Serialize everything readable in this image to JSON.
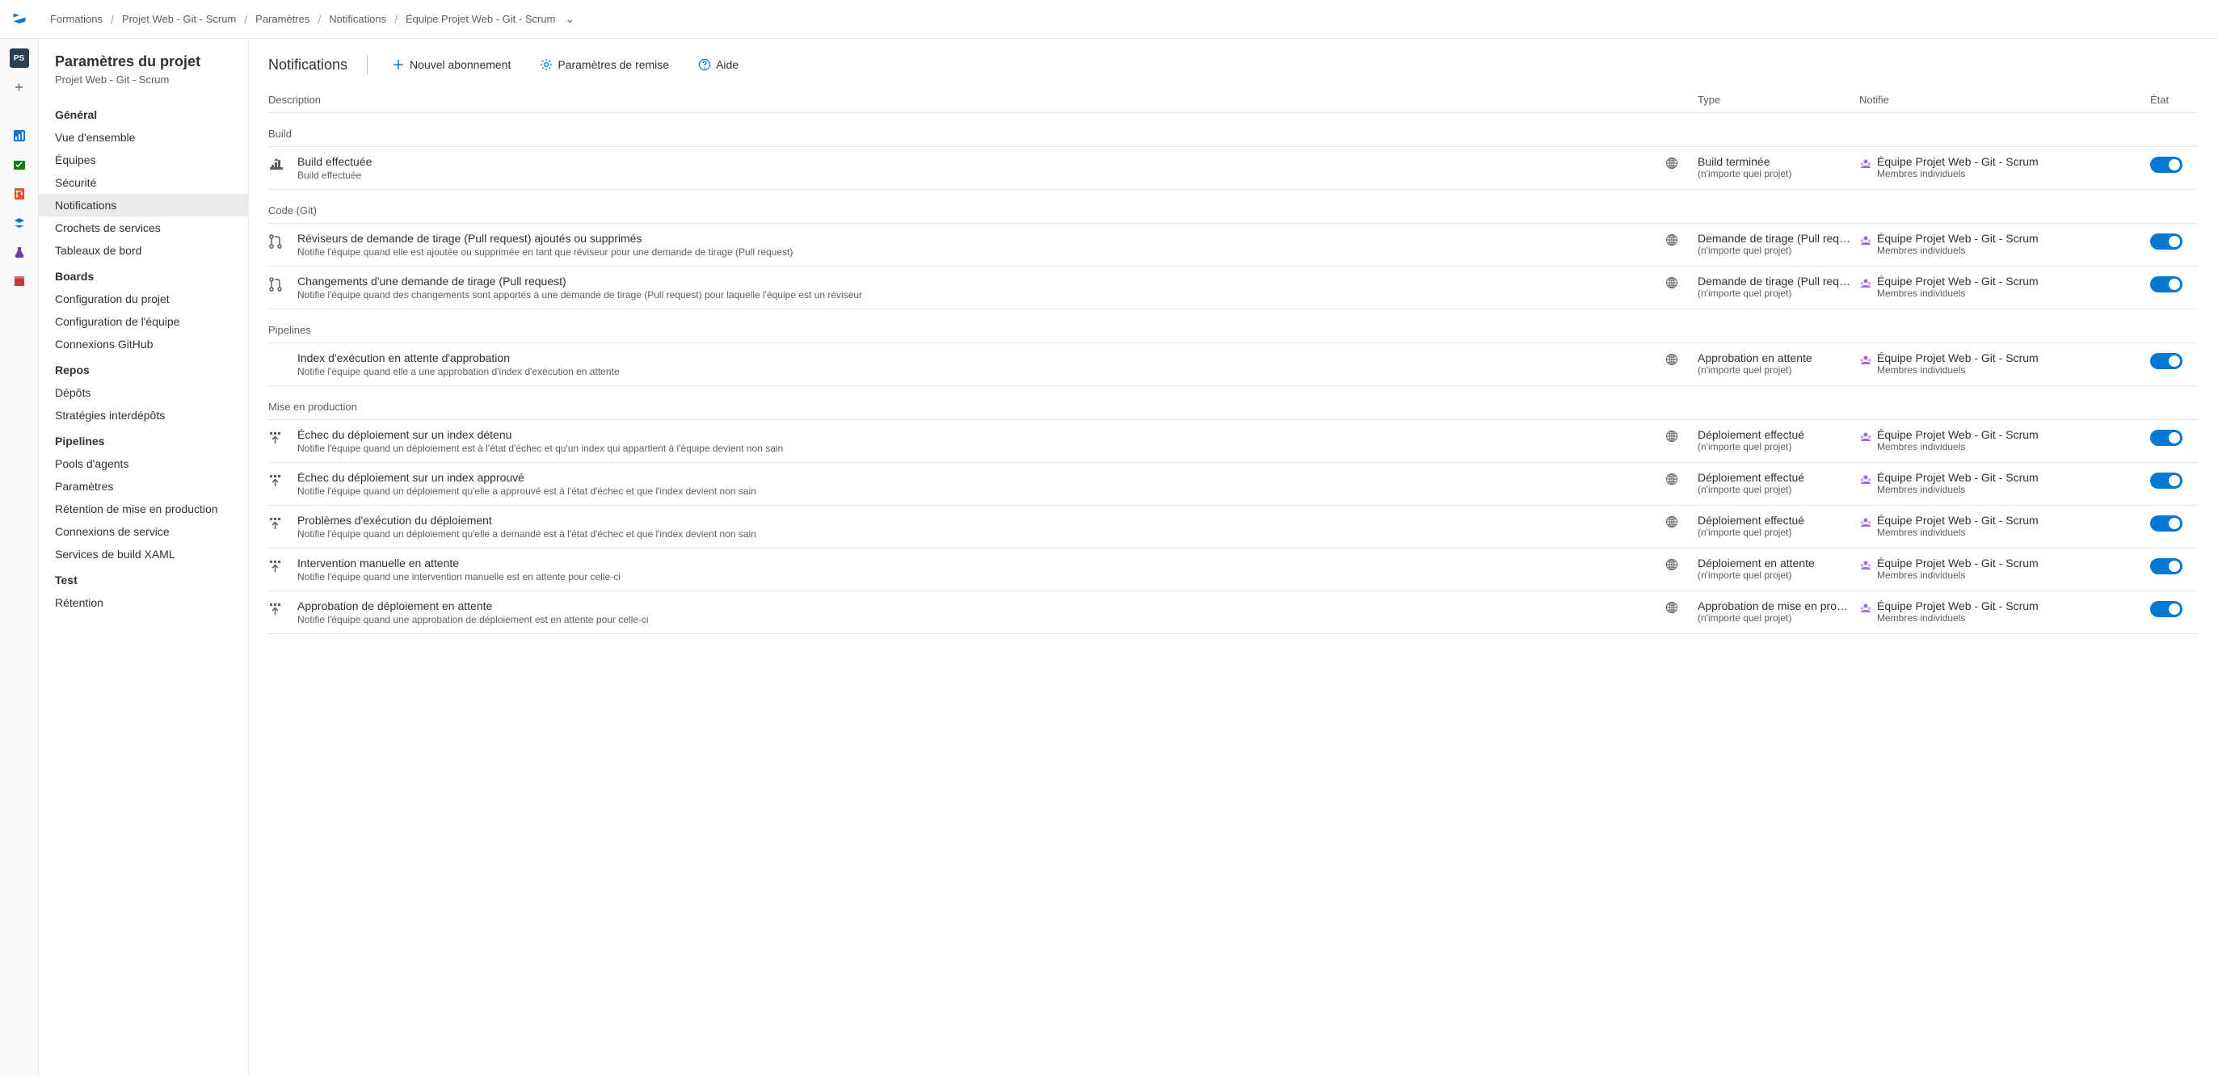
{
  "breadcrumb": {
    "items": [
      "Formations",
      "Projet Web - Git - Scrum",
      "Paramètres",
      "Notifications",
      "Équipe Projet Web - Git - Scrum"
    ]
  },
  "rail": {
    "project_initials": "PS"
  },
  "sidebar": {
    "title": "Paramètres du projet",
    "subtitle": "Projet Web - Git - Scrum",
    "groups": [
      {
        "label": "Général",
        "items": [
          "Vue d'ensemble",
          "Équipes",
          "Sécurité",
          "Notifications",
          "Crochets de services",
          "Tableaux de bord"
        ],
        "active": 3
      },
      {
        "label": "Boards",
        "items": [
          "Configuration du projet",
          "Configuration de l'équipe",
          "Connexions GitHub"
        ]
      },
      {
        "label": "Repos",
        "items": [
          "Dépôts",
          "Stratégies interdépôts"
        ]
      },
      {
        "label": "Pipelines",
        "items": [
          "Pools d'agents",
          "Paramètres",
          "Rétention de mise en production",
          "Connexions de service",
          "Services de build XAML"
        ]
      },
      {
        "label": "Test",
        "items": [
          "Rétention"
        ]
      }
    ]
  },
  "header": {
    "title": "Notifications",
    "cmd_new": "Nouvel abonnement",
    "cmd_delivery": "Paramètres de remise",
    "cmd_help": "Aide"
  },
  "columns": {
    "desc": "Description",
    "type": "Type",
    "notify": "Notifie",
    "state": "État"
  },
  "notify_target": {
    "name": "Équipe Projet Web - Git - Scrum",
    "role": "Membres individuels"
  },
  "any_project": "(n'importe quel projet)",
  "cats": [
    {
      "label": "Build",
      "rows": [
        {
          "icon": "build",
          "title": "Build effectuée",
          "sub": "Build effectuée",
          "type": "Build terminée"
        }
      ]
    },
    {
      "label": "Code (Git)",
      "rows": [
        {
          "icon": "pr",
          "title": "Réviseurs de demande de tirage (Pull request) ajoutés ou supprimés",
          "sub": "Notifie l'équipe quand elle est ajoutée ou supprimée en tant que réviseur pour une demande de tirage (Pull request)",
          "type": "Demande de tirage (Pull req…"
        },
        {
          "icon": "pr",
          "title": "Changements d'une demande de tirage (Pull request)",
          "sub": "Notifie l'équipe quand des changements sont apportés à une demande de tirage (Pull request) pour laquelle l'équipe est un réviseur",
          "type": "Demande de tirage (Pull req…"
        }
      ]
    },
    {
      "label": "Pipelines",
      "rows": [
        {
          "icon": "none",
          "title": "Index d'exécution en attente d'approbation",
          "sub": "Notifie l'équipe quand elle a une approbation d'index d'exécution en attente",
          "type": "Approbation en attente"
        }
      ]
    },
    {
      "label": "Mise en production",
      "rows": [
        {
          "icon": "deploy",
          "title": "Échec du déploiement sur un index détenu",
          "sub": "Notifie l'équipe quand un déploiement est à l'état d'échec et qu'un index qui appartient à l'équipe devient non sain",
          "type": "Déploiement effectué"
        },
        {
          "icon": "deploy",
          "title": "Échec du déploiement sur un index approuvé",
          "sub": "Notifie l'équipe quand un déploiement qu'elle a approuvé est à l'état d'échec et que l'index devient non sain",
          "type": "Déploiement effectué"
        },
        {
          "icon": "deploy",
          "title": "Problèmes d'exécution du déploiement",
          "sub": "Notifie l'équipe quand un déploiement qu'elle a demandé est à l'état d'échec et que l'index devient non sain",
          "type": "Déploiement effectué"
        },
        {
          "icon": "deploy",
          "title": "Intervention manuelle en attente",
          "sub": "Notifie l'équipe quand une intervention manuelle est en attente pour celle-ci",
          "type": "Déploiement en attente"
        },
        {
          "icon": "deploy",
          "title": "Approbation de déploiement en attente",
          "sub": "Notifie l'équipe quand une approbation de déploiement est en attente pour celle-ci",
          "type": "Approbation de mise en pro…"
        }
      ]
    }
  ]
}
